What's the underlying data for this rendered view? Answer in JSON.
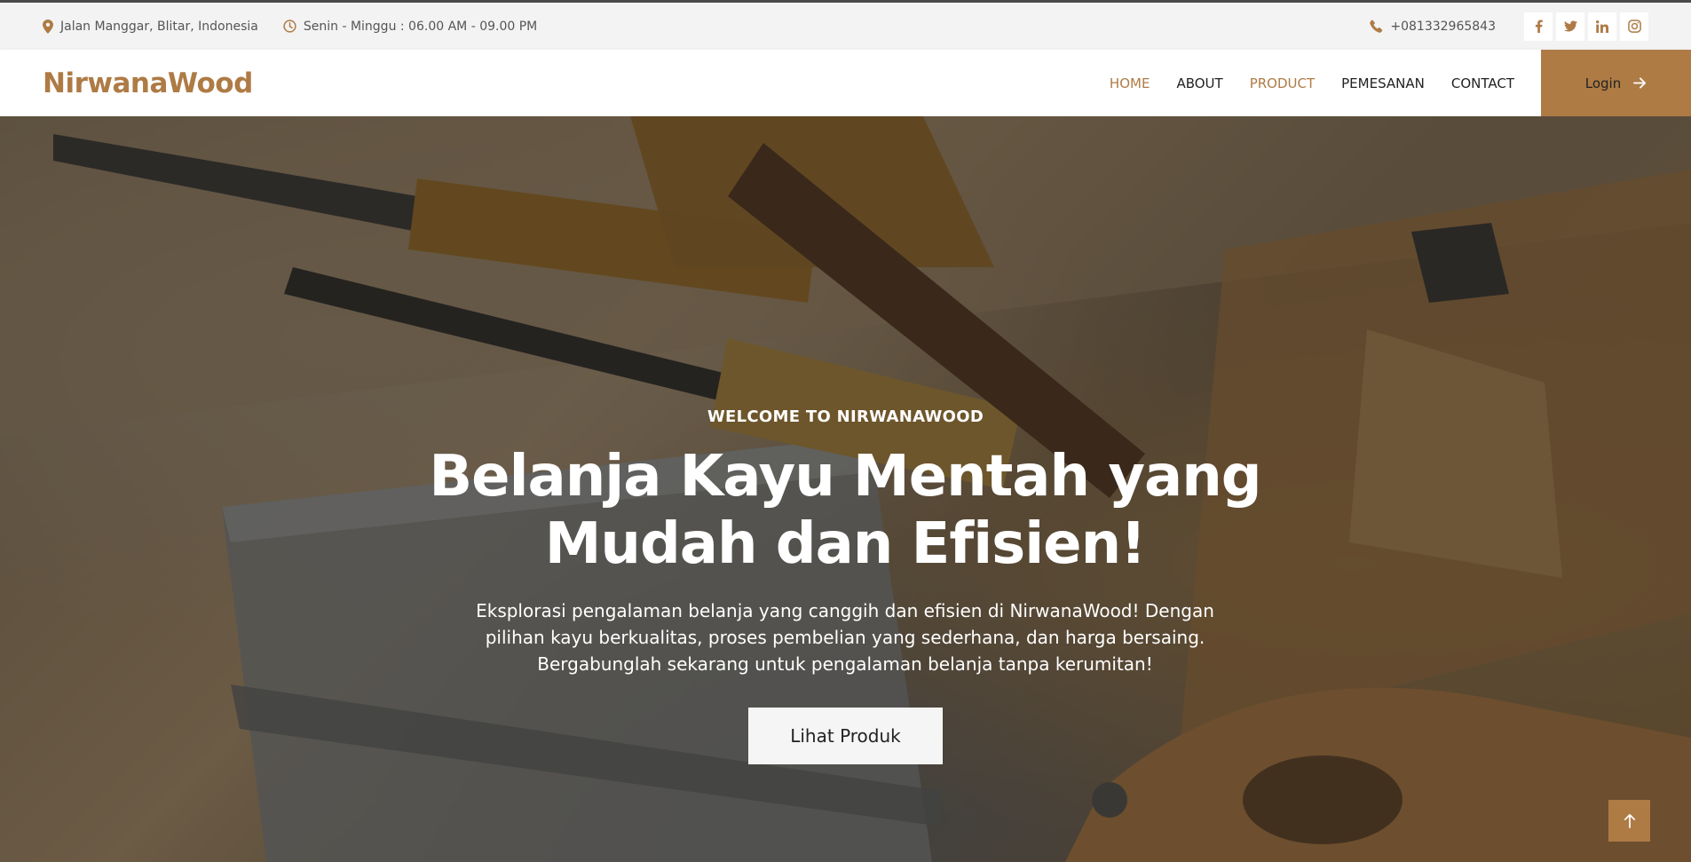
{
  "topbar": {
    "address": "Jalan Manggar, Blitar, Indonesia",
    "hours": "Senin - Minggu : 06.00 AM - 09.00 PM",
    "phone": "+081332965843",
    "social": [
      "f",
      "t",
      "in",
      "ig"
    ]
  },
  "nav": {
    "brand": "NirwanaWood",
    "items": [
      {
        "label": "HOME"
      },
      {
        "label": "ABOUT"
      },
      {
        "label": "PRODUCT"
      },
      {
        "label": "PEMESANAN"
      },
      {
        "label": "CONTACT"
      }
    ],
    "login": "Login"
  },
  "hero": {
    "eyebrow": "WELCOME TO NIRWANAWOOD",
    "headline": "Belanja Kayu Mentah yang Mudah dan Efisien!",
    "subtext": "Eksplorasi pengalaman belanja yang canggih dan efisien di NirwanaWood! Dengan pilihan kayu berkualitas, proses pembelian yang sederhana, dan harga bersaing. Bergabunglah sekarang untuk pengalaman belanja tanpa kerumitan!",
    "cta": "Lihat Produk"
  },
  "colors": {
    "accent": "#ae7b45",
    "topbar_bg": "#f3f3f3"
  },
  "icons": {
    "address": "map-pin-icon",
    "hours": "clock-icon",
    "phone": "phone-icon",
    "login": "arrow-right-icon",
    "back_to_top": "arrow-up-icon"
  }
}
